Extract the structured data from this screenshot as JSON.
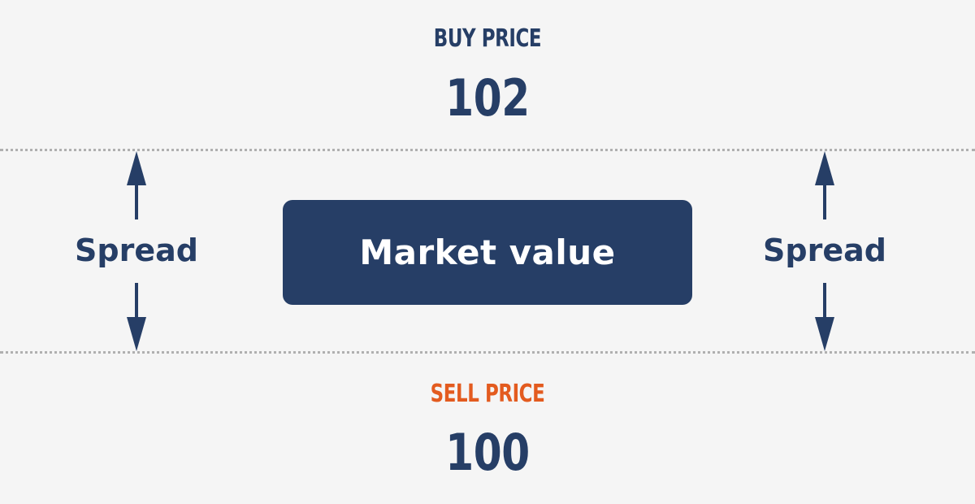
{
  "buy": {
    "title": "BUY PRICE",
    "value": "102"
  },
  "sell": {
    "title": "SELL PRICE",
    "value": "100"
  },
  "market": {
    "label": "Market value"
  },
  "spread": {
    "left_label": "Spread",
    "right_label": "Spread"
  },
  "colors": {
    "navy": "#263e66",
    "orange": "#e35b1f",
    "background": "#f5f5f5",
    "dotted_line": "#b0b0b0"
  },
  "icons": {
    "up": "arrow-up-icon",
    "down": "arrow-down-icon"
  }
}
